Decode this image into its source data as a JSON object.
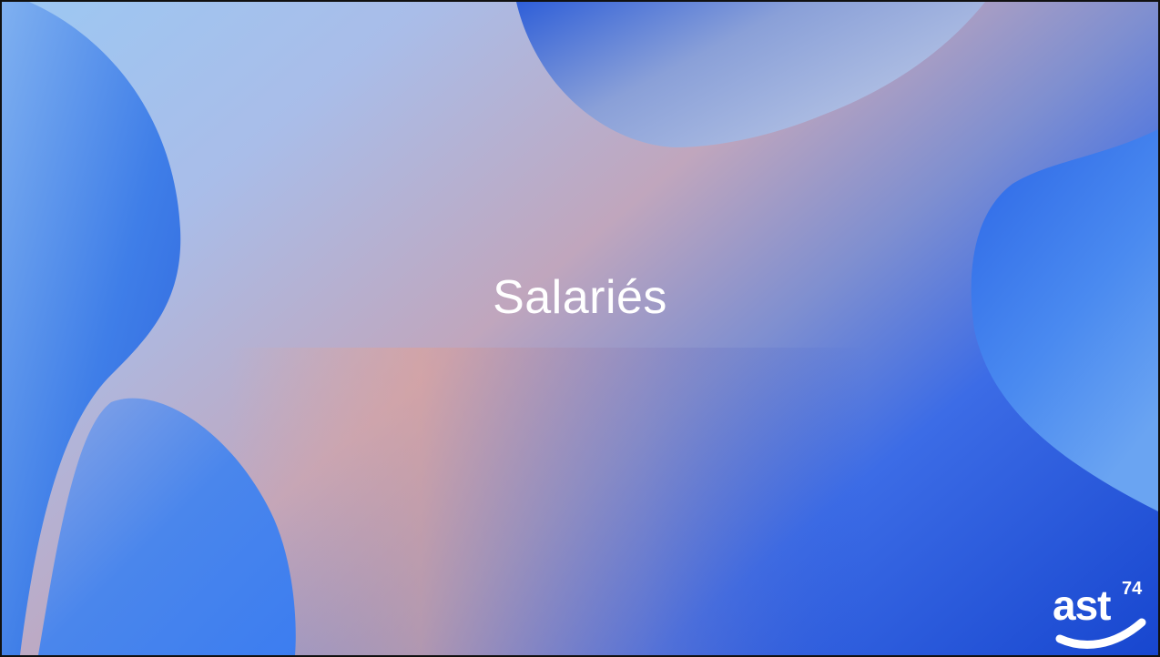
{
  "slide": {
    "title": "Salariés"
  },
  "logo": {
    "word": "ast",
    "superscript": "74"
  },
  "colors": {
    "title_text": "#ffffff",
    "blob_blue": "#2f6fe8",
    "deep_blue": "#1a45cf",
    "light_sky": "#9cc8f3",
    "peach": "#e8a592"
  }
}
